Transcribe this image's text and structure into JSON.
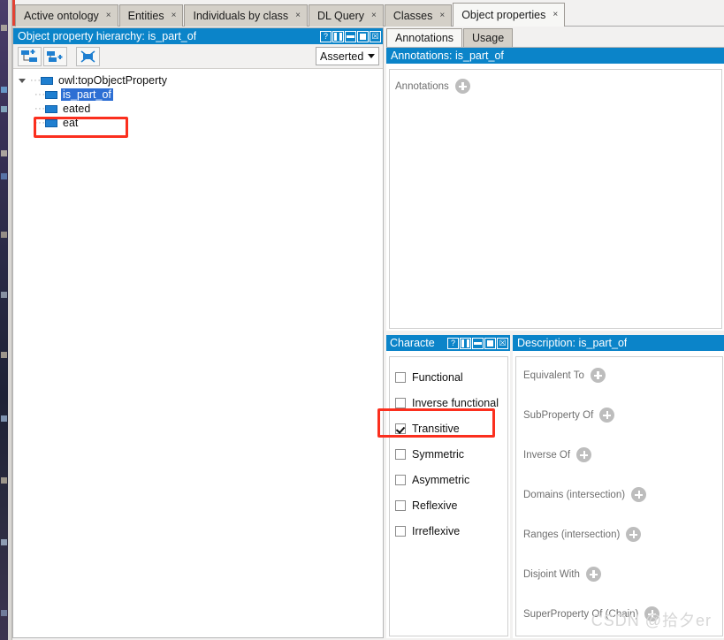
{
  "window": {
    "tabs": [
      {
        "label": "Active ontology",
        "active": false,
        "close": "×"
      },
      {
        "label": "Entities",
        "active": false,
        "close": "×"
      },
      {
        "label": "Individuals by class",
        "active": false,
        "close": "×"
      },
      {
        "label": "DL Query",
        "active": false,
        "close": "×"
      },
      {
        "label": "Classes",
        "active": false,
        "close": "×"
      },
      {
        "label": "Object properties",
        "active": true,
        "close": "×"
      }
    ]
  },
  "hierarchy": {
    "title": "Object property hierarchy: is_part_of",
    "toolbar": {
      "add_subproperty": "add-subproperty-icon",
      "add_sibling": "add-sibling-property-icon",
      "delete_property": "delete-property-icon"
    },
    "view_selector": {
      "value": "Asserted",
      "caret": "▼"
    },
    "tree": [
      {
        "label": "owl:topObjectProperty",
        "level": 0,
        "selected": false,
        "expanded": true
      },
      {
        "label": "is_part_of",
        "level": 1,
        "selected": true,
        "expanded": false
      },
      {
        "label": "eated",
        "level": 1,
        "selected": false,
        "expanded": false
      },
      {
        "label": "eat",
        "level": 1,
        "selected": false,
        "expanded": false
      }
    ]
  },
  "annotations_view": {
    "tabs": [
      {
        "label": "Annotations",
        "active": true
      },
      {
        "label": "Usage",
        "active": false
      }
    ],
    "title": "Annotations: is_part_of",
    "sections": [
      {
        "label": "Annotations",
        "add": "add-icon"
      }
    ]
  },
  "characteristics": {
    "title": "Characte",
    "items": [
      {
        "label": "Functional",
        "checked": false
      },
      {
        "label": "Inverse functional",
        "checked": false
      },
      {
        "label": "Transitive",
        "checked": true
      },
      {
        "label": "Symmetric",
        "checked": false
      },
      {
        "label": "Asymmetric",
        "checked": false
      },
      {
        "label": "Reflexive",
        "checked": false
      },
      {
        "label": "Irreflexive",
        "checked": false
      }
    ]
  },
  "description": {
    "title": "Description: is_part_of",
    "rows": [
      {
        "label": "Equivalent To",
        "add": "add-icon"
      },
      {
        "label": "SubProperty Of",
        "add": "add-icon"
      },
      {
        "label": "Inverse Of",
        "add": "add-icon"
      },
      {
        "label": "Domains (intersection)",
        "add": "add-icon"
      },
      {
        "label": "Ranges (intersection)",
        "add": "add-icon"
      },
      {
        "label": "Disjoint With",
        "add": "add-icon"
      },
      {
        "label": "SuperProperty Of (Chain)",
        "add": "add-icon"
      }
    ]
  },
  "window_controls": [
    {
      "name": "help",
      "glyph": "?"
    },
    {
      "name": "split-view",
      "glyph": ""
    },
    {
      "name": "minimize",
      "glyph": ""
    },
    {
      "name": "maximize",
      "glyph": ""
    },
    {
      "name": "close",
      "glyph": "☒"
    }
  ],
  "watermark": "CSDN @拾夕er",
  "colors": {
    "panel_title_blue": "#0b84c9",
    "selection_blue": "#2d6fd4",
    "annotation_red": "#fb2f1e",
    "property_icon_blue": "#1f7fd0"
  }
}
